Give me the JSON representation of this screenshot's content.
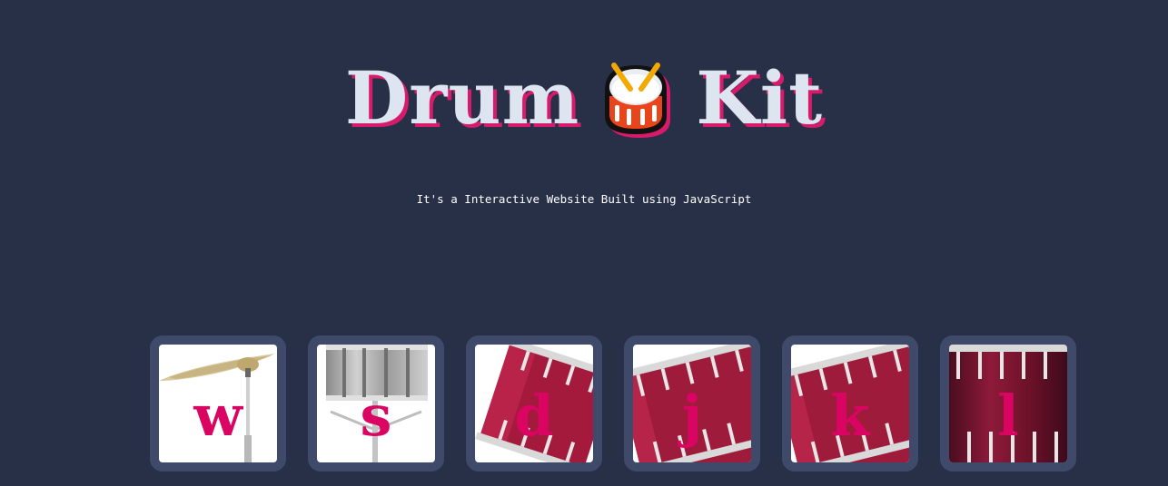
{
  "header": {
    "title_left": "Drum",
    "title_right": "Kit",
    "emoji_icon": "drum-emoji-icon",
    "subtitle": "It's a Interactive Website Built using JavaScript"
  },
  "colors": {
    "background": "#283048",
    "title": "#dde5f0",
    "title_shadow": "#d81a6a",
    "key_letter": "#da0463",
    "tile_border": "#3f4a6b"
  },
  "drums": [
    {
      "key": "w",
      "icon": "crash-cymbal-icon"
    },
    {
      "key": "s",
      "icon": "snare-drum-icon"
    },
    {
      "key": "d",
      "icon": "tom-1-icon"
    },
    {
      "key": "j",
      "icon": "tom-2-icon"
    },
    {
      "key": "k",
      "icon": "tom-3-icon"
    },
    {
      "key": "l",
      "icon": "kick-drum-icon"
    }
  ]
}
